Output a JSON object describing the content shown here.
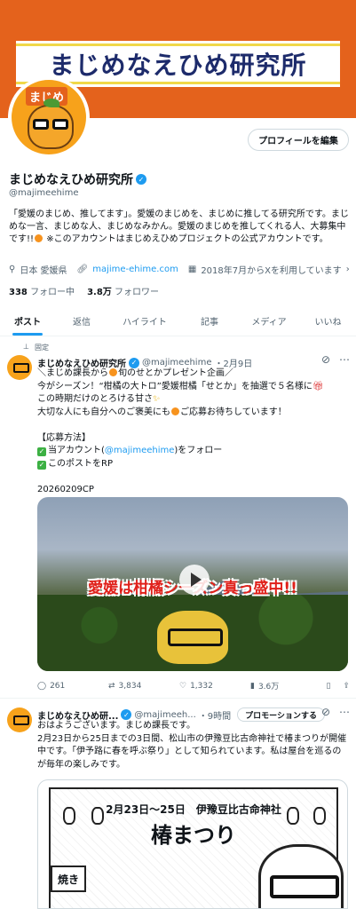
{
  "profile": {
    "banner_title": "まじめなえひめ研究所",
    "avatar_tag": "まじめ",
    "edit_button": "プロフィールを編集",
    "name": "まじめなえひめ研究所",
    "handle": "@majimeehime",
    "bio_1": "「愛媛のまじめ、推してます」。愛媛のまじめを、まじめに推してる研究所です。まじめな一言、まじめな人、まじめなみかん。愛媛のまじめを推してくれる人、大募集中です!!",
    "bio_2": " ※このアカウントはまじめえひめプロジェクトの公式アカウントです。",
    "location": "日本 愛媛県",
    "website": "majime-ehime.com",
    "joined": "2018年7月からXを利用しています",
    "following_count": "338",
    "following_label": "フォロー中",
    "followers_count": "3.8万",
    "followers_label": "フォロワー"
  },
  "tabs": [
    "ポスト",
    "返信",
    "ハイライト",
    "記事",
    "メディア",
    "いいね"
  ],
  "tweet1": {
    "pinned_label": "固定",
    "name": "まじめなえひめ研究所",
    "handle": "@majimeehime",
    "date": "・2月9日",
    "line1": "＼まじめ課長から",
    "line1b": "旬のせとかプレゼント企画／",
    "line2": "今がシーズン！“柑橘の大トロ”愛媛柑橘「せとか」を抽選で５名様に",
    "line3": "この時期だけのとろける甘さ",
    "line4": "大切な人にも自分へのご褒美にも",
    "line4b": "ご応募お待ちしています！",
    "apply_title": "【応募方法】",
    "step1_pre": "当アカウント(",
    "step1_link": "@majimeehime",
    "step1_post": ")をフォロー",
    "step2": "このポストをRP",
    "code": "20260209CP",
    "video_caption": "愛媛は柑橘シーズン真っ盛中!!",
    "replies": "261",
    "reposts": "3,834",
    "likes": "1,332",
    "views": "3.6万"
  },
  "tweet2": {
    "name": "まじめなえひめ研...",
    "handle": "@majimeeh...",
    "time": "・9時間",
    "promo": "プロモーションする",
    "line1": "おはようございます。まじめ課長です。",
    "line2": "2月23日から25日までの3日間、松山市の伊豫豆比古命神社で椿まつりが開催中です。「伊予路に春を呼ぶ祭り」として知られています。私は屋台を巡るのが毎年の楽しみです。",
    "poster_dates": "2月23日～25日　伊豫豆比古命神社",
    "poster_title": "椿まつり",
    "poster_yaki": "焼き"
  },
  "colors": {
    "accent": "#1d9bf0",
    "banner": "#e4621c",
    "text": "#0f1419",
    "muted": "#536471"
  }
}
